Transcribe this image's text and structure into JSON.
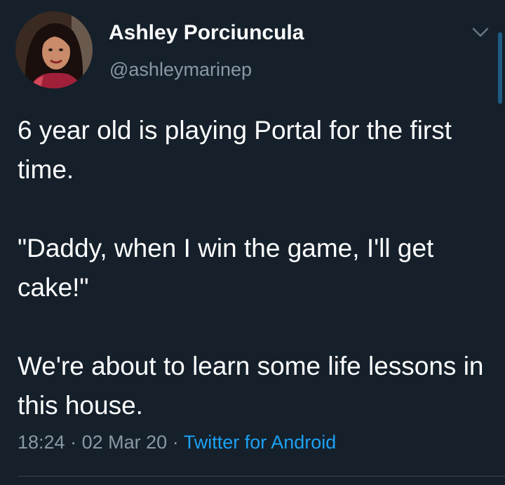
{
  "tweet": {
    "author": {
      "name": "Ashley Porciuncula",
      "handle": "@ashleymarinep"
    },
    "paragraphs": [
      "6 year old is playing Portal for the first time.",
      "\"Daddy, when I win the game, I'll get cake!\"",
      "We're about to learn some life lessons in this house."
    ],
    "time": "18:24",
    "separator": "·",
    "date": "02 Mar 20",
    "source": "Twitter for Android"
  },
  "icons": {
    "menu": "chevron-down-icon",
    "avatar": "avatar"
  },
  "colors": {
    "background": "#15202b",
    "text_primary": "#ffffff",
    "text_secondary": "#8899a6",
    "link": "#1da1f2",
    "divider": "#38444d"
  }
}
